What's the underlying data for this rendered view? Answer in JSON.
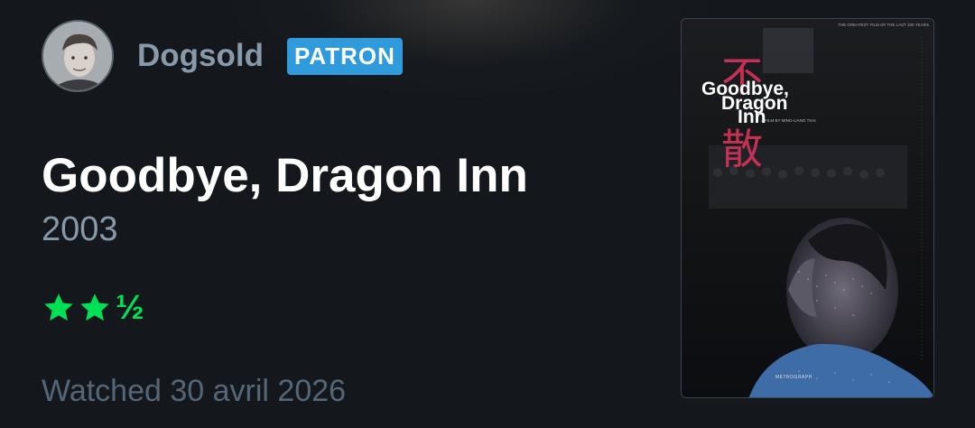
{
  "user": {
    "name": "Dogsold",
    "badge": "PATRON"
  },
  "film": {
    "title": "Goodbye, Dragon Inn",
    "year": "2003",
    "rating": {
      "stars": 2.5,
      "max": 5,
      "half_glyph": "½"
    },
    "watched_text": "Watched 30 avril 2026"
  },
  "poster": {
    "title_line1": "Goodbye,",
    "title_line2": "Dragon",
    "title_line3": "Inn",
    "tagline": "THE GREATEST FILM OF THE LAST 100 YEARS",
    "credit": "A FILM BY MING-LIANG TSAI",
    "distributor": "METROGRAPH"
  },
  "colors": {
    "background": "#14181c",
    "accent_green": "#00e054",
    "badge_blue": "#2f9bdc",
    "muted_text": "#8899aa"
  }
}
